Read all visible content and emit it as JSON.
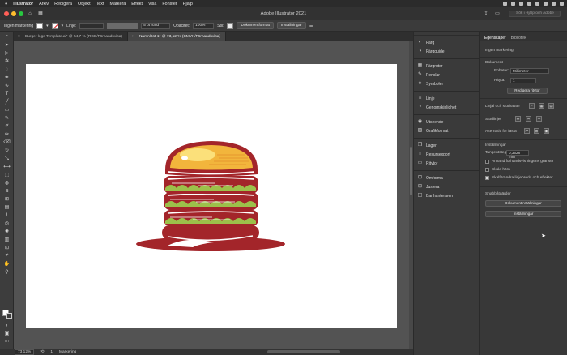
{
  "menubar": {
    "app": "Illustrator",
    "items": [
      "Arkiv",
      "Redigera",
      "Objekt",
      "Text",
      "Markera",
      "Effekt",
      "Visa",
      "Fönster",
      "Hjälp"
    ]
  },
  "window": {
    "title": "Adobe Illustrator 2021",
    "search_placeholder": "Sök i Hjälp och Adobe",
    "colors": {
      "close": "#ff5f57",
      "minimize": "#febc2e",
      "zoom": "#28c840"
    }
  },
  "control_bar": {
    "selection": "Ingen markering",
    "stroke_label": "Linje:",
    "brush": "5 pt rund",
    "opacity_label": "Opacitet:",
    "opacity_value": "100%",
    "style_label": "Stil:",
    "document_setup": "Dokumentformat",
    "preferences": "Inställningar"
  },
  "tabs": [
    {
      "label": "Burger logo Template.ai* @ 54,7 % (RGB/Förhandsvisa)",
      "active": false
    },
    {
      "label": "Namnlöst-1* @ 73,12 % (CMYK/Förhandsvisa)",
      "active": true
    }
  ],
  "statusbar": {
    "zoom": "73,12%",
    "page": "1",
    "tool": "Markering"
  },
  "dock_groups": [
    [
      {
        "label": "Färg",
        "icon": "color-icon"
      },
      {
        "label": "Färgguide",
        "icon": "color-guide-icon"
      }
    ],
    [
      {
        "label": "Färgrutor",
        "icon": "swatches-icon"
      },
      {
        "label": "Penslar",
        "icon": "brushes-icon"
      },
      {
        "label": "Symboler",
        "icon": "symbols-icon"
      }
    ],
    [
      {
        "label": "Linje",
        "icon": "stroke-icon"
      },
      {
        "label": "Genomskinlighet",
        "icon": "transparency-icon"
      }
    ],
    [
      {
        "label": "Utseende",
        "icon": "appearance-icon"
      },
      {
        "label": "Grafikformat",
        "icon": "graphic-styles-icon"
      }
    ],
    [
      {
        "label": "Lager",
        "icon": "layers-icon"
      },
      {
        "label": "Resursexport",
        "icon": "asset-export-icon"
      },
      {
        "label": "Ritytor",
        "icon": "artboards-icon"
      }
    ],
    [
      {
        "label": "Omforma",
        "icon": "transform-icon"
      },
      {
        "label": "Justera",
        "icon": "align-icon"
      },
      {
        "label": "Banhanteraren",
        "icon": "pathfinder-icon"
      }
    ]
  ],
  "properties": {
    "tabs": [
      "Egenskaper",
      "Bibliotek"
    ],
    "no_selection": "Ingen markering",
    "document": "Dokument",
    "units_label": "Enheter:",
    "units_value": "Millimeter",
    "artboard_label": "Rityta:",
    "artboard_value": "1",
    "edit_artboards": "Redigera ritytor",
    "rulers_grids": "Linjal och stödraster",
    "guides": "Stödlinjer",
    "snap_options": "Alternativ för fästa",
    "preferences_title": "Inställningar",
    "key_increment_label": "Tangentsteg:",
    "key_increment_value": "0,3528 mm",
    "check_preview_bounds": "Använd förhandsvisningens gränser",
    "check_scale_corners": "Skala hörn",
    "check_scale_strokes": "Skalförändra linjebredd och effekter",
    "quick_actions": "Snabbåtgärder",
    "document_setup": "Dokumentinställningar",
    "preferences": "Inställningar"
  },
  "burger_colors": {
    "dark": "#a3252a",
    "bun": "#f2b53c",
    "bun_light": "#fbe07a",
    "lettuce": "#9cc04a",
    "cream": "#f6e2b8"
  }
}
